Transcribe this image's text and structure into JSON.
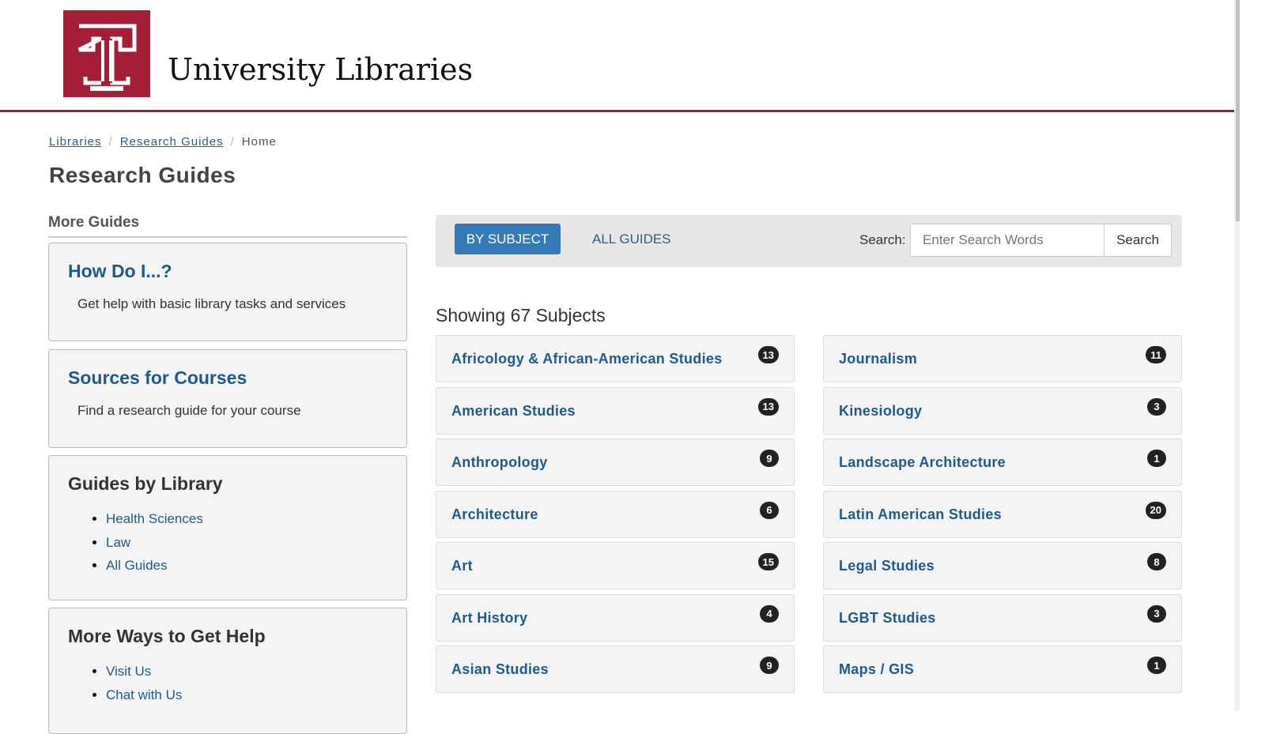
{
  "header": {
    "title": "University Libraries",
    "brand_color": "#a41e35"
  },
  "breadcrumb": [
    "Libraries",
    "Research Guides",
    "Home"
  ],
  "page_title": "Research Guides",
  "sidebar": {
    "heading": "More Guides",
    "how_do_i": {
      "title": "How Do I...?",
      "desc": "Get help with basic library tasks and services"
    },
    "sources": {
      "title": "Sources for Courses",
      "desc": "Find a research guide for your course"
    },
    "by_library": {
      "title": "Guides by Library",
      "items": [
        "Health Sciences",
        "Law",
        "All Guides"
      ]
    },
    "more_help": {
      "title": "More Ways to Get Help",
      "items": [
        "Visit Us",
        "Chat with Us"
      ]
    }
  },
  "toolbar": {
    "by_subject": "BY SUBJECT",
    "all_guides": "ALL GUIDES",
    "search_label": "Search:",
    "search_placeholder": "Enter Search Words",
    "search_button": "Search"
  },
  "showing": "Showing 67 Subjects",
  "subjects_left": [
    {
      "name": "Africology & African-American Studies",
      "count": "13"
    },
    {
      "name": "American Studies",
      "count": "13"
    },
    {
      "name": "Anthropology",
      "count": "9"
    },
    {
      "name": "Architecture",
      "count": "6"
    },
    {
      "name": "Art",
      "count": "15"
    },
    {
      "name": "Art History",
      "count": "4"
    },
    {
      "name": "Asian Studies",
      "count": "9"
    }
  ],
  "subjects_right": [
    {
      "name": "Journalism",
      "count": "11"
    },
    {
      "name": "Kinesiology",
      "count": "3"
    },
    {
      "name": "Landscape Architecture",
      "count": "1"
    },
    {
      "name": "Latin American Studies",
      "count": "20"
    },
    {
      "name": "Legal Studies",
      "count": "8"
    },
    {
      "name": "LGBT Studies",
      "count": "3"
    },
    {
      "name": "Maps / GIS",
      "count": "1"
    }
  ]
}
